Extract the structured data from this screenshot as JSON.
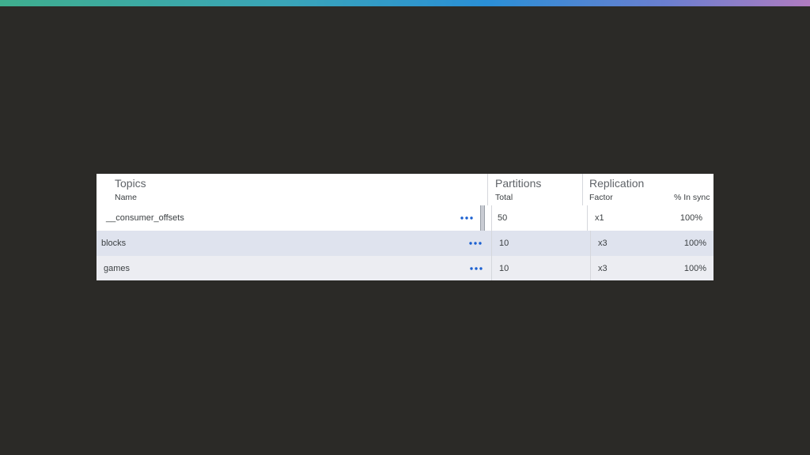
{
  "table": {
    "groups": {
      "topics": "Topics",
      "partitions": "Partitions",
      "replication": "Replication"
    },
    "columns": {
      "name": "Name",
      "total": "Total",
      "factor": "Factor",
      "in_sync": "% In sync"
    },
    "rows": [
      {
        "name": "__consumer_offsets",
        "total": "50",
        "factor": "x1",
        "in_sync": "100%"
      },
      {
        "name": "blocks",
        "total": "10",
        "factor": "x3",
        "in_sync": "100%"
      },
      {
        "name": "games",
        "total": "10",
        "factor": "x3",
        "in_sync": "100%"
      }
    ]
  },
  "icons": {
    "row_menu": "more-horizontal-icon"
  },
  "colors": {
    "accent_blue": "#1a5fd0",
    "selected_row": "#dfe3ee",
    "alt_row": "#ecedf2"
  }
}
